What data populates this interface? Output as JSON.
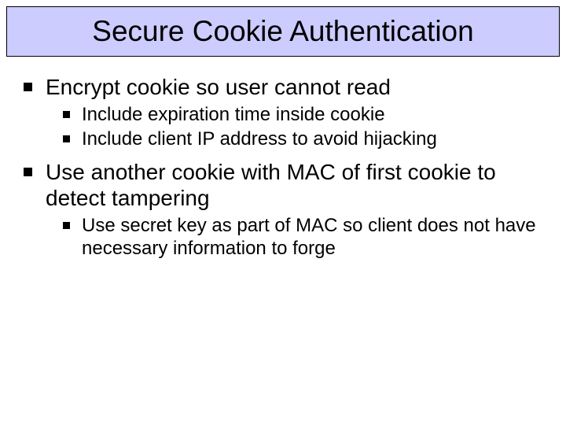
{
  "title": "Secure Cookie Authentication",
  "bullets": {
    "b1": "Encrypt cookie so user cannot read",
    "b1_sub": {
      "s1": "Include expiration time inside cookie",
      "s2": "Include client IP address to avoid hijacking"
    },
    "b2": "Use another cookie with MAC of first cookie to detect tampering",
    "b2_sub": {
      "s1": "Use secret key as part of MAC so client does not have necessary information to forge"
    }
  }
}
